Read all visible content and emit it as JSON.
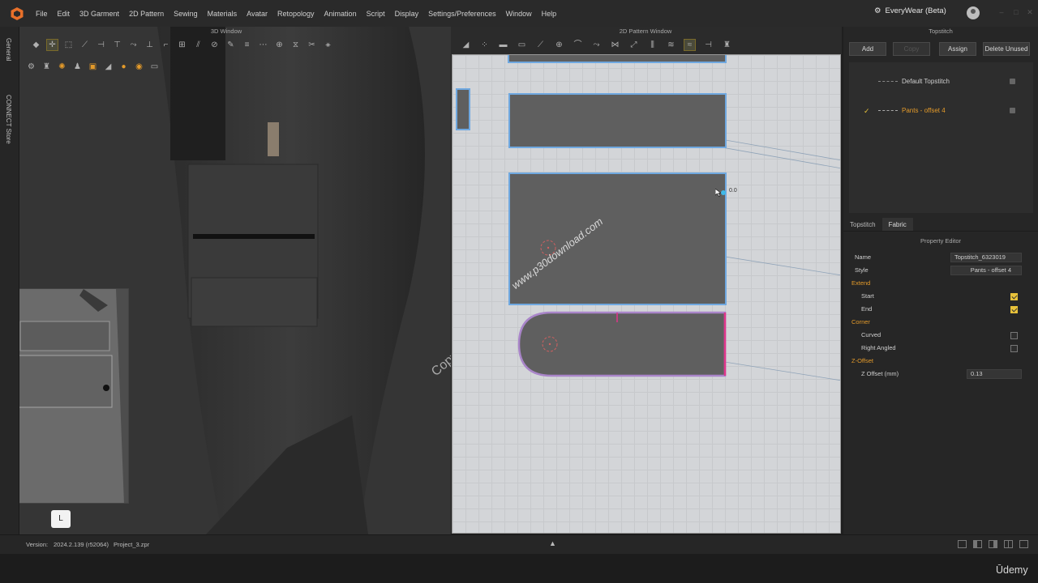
{
  "menubar": {
    "items": [
      "File",
      "Edit",
      "3D Garment",
      "2D Pattern",
      "Sewing",
      "Materials",
      "Avatar",
      "Retopology",
      "Animation",
      "Script",
      "Display",
      "Settings/Preferences",
      "Window",
      "Help"
    ],
    "workspace": "EveryWear (Beta)"
  },
  "left_strip": {
    "tabs": [
      "General",
      "CONNECT Store"
    ]
  },
  "window3d": {
    "title": "3D Window",
    "lbutton": "L",
    "watermark": "Copy"
  },
  "window2d": {
    "title": "2D Pattern Window",
    "watermark": "www.p30download.com",
    "point_label": "0.0"
  },
  "topstitch": {
    "title": "Topstitch",
    "buttons": {
      "add": "Add",
      "copy": "Copy",
      "assign": "Assign",
      "delete_unused": "Delete Unused"
    },
    "items": [
      {
        "label": "Default Topstitch",
        "selected": false
      },
      {
        "label": "Pants - offset 4",
        "selected": true
      }
    ]
  },
  "tabs": [
    "Topstitch",
    "Fabric"
  ],
  "property_editor": {
    "title": "Property Editor",
    "name_label": "Name",
    "name_value": "Topstitch_6323019",
    "style_label": "Style",
    "style_value": "Pants - offset 4",
    "extend_section": "Extend",
    "start_label": "Start",
    "start_checked": true,
    "end_label": "End",
    "end_checked": true,
    "corner_section": "Corner",
    "curved_label": "Curved",
    "curved_checked": false,
    "right_angled_label": "Right Angled",
    "right_angled_checked": false,
    "zoffset_section": "Z-Offset",
    "zoffset_label": "Z Offset (mm)",
    "zoffset_value": "0.13"
  },
  "status": {
    "version_label": "Version:",
    "version_value": "2024.2.139 (r52064)",
    "project": "Project_3.zpr"
  },
  "footer": {
    "brand": "Ūdemy"
  },
  "colors": {
    "accent": "#e39a2a",
    "selection_blue": "#6fa8e0",
    "stitch_pink": "#e0358a"
  }
}
